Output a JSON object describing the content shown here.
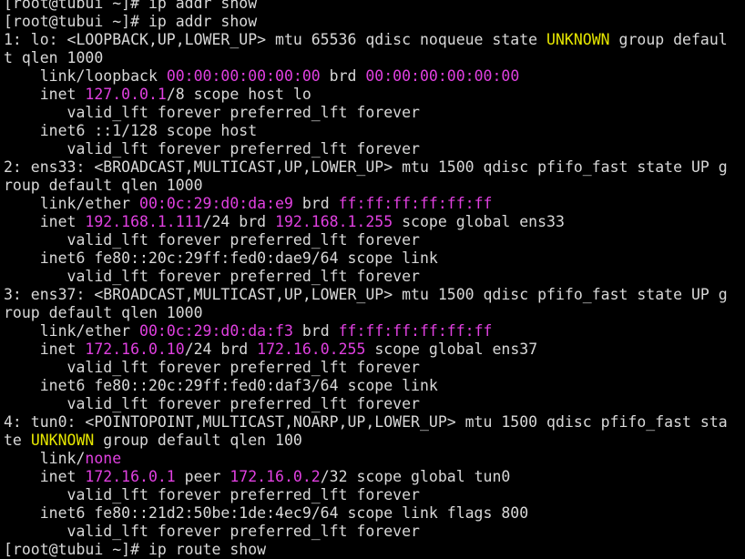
{
  "terminal": {
    "colors": {
      "background": "#000000",
      "text": "#d8d8d8",
      "address_highlight": "#e040e0",
      "state_highlight": "#e6e600"
    },
    "lines": [
      [
        {
          "t": "[root@tubui ~]# ip addr show"
        }
      ],
      [
        {
          "t": "[root@tubui ~]# ip addr show"
        }
      ],
      [
        {
          "t": "1: lo: <LOOPBACK,UP,LOWER_UP> mtu 65536 qdisc noqueue state "
        },
        {
          "t": "UNKNOWN",
          "c": "yel"
        },
        {
          "t": " group defaul"
        }
      ],
      [
        {
          "t": "t qlen 1000"
        }
      ],
      [
        {
          "t": "    link/loopback "
        },
        {
          "t": "00:00:00:00:00:00",
          "c": "mag"
        },
        {
          "t": " brd "
        },
        {
          "t": "00:00:00:00:00:00",
          "c": "mag"
        }
      ],
      [
        {
          "t": "    inet "
        },
        {
          "t": "127.0.0.1",
          "c": "mag"
        },
        {
          "t": "/8 scope host lo"
        }
      ],
      [
        {
          "t": "       valid_lft forever preferred_lft forever"
        }
      ],
      [
        {
          "t": "    inet6 ::1/128 scope host"
        }
      ],
      [
        {
          "t": "       valid_lft forever preferred_lft forever"
        }
      ],
      [
        {
          "t": "2: ens33: <BROADCAST,MULTICAST,UP,LOWER_UP> mtu 1500 qdisc pfifo_fast state UP g"
        }
      ],
      [
        {
          "t": "roup default qlen 1000"
        }
      ],
      [
        {
          "t": "    link/ether "
        },
        {
          "t": "00:0c:29:d0:da:e9",
          "c": "mag"
        },
        {
          "t": " brd "
        },
        {
          "t": "ff:ff:ff:ff:ff:ff",
          "c": "mag"
        }
      ],
      [
        {
          "t": "    inet "
        },
        {
          "t": "192.168.1.111",
          "c": "mag"
        },
        {
          "t": "/24 brd "
        },
        {
          "t": "192.168.1.255",
          "c": "mag"
        },
        {
          "t": " scope global ens33"
        }
      ],
      [
        {
          "t": "       valid_lft forever preferred_lft forever"
        }
      ],
      [
        {
          "t": "    inet6 fe80::20c:29ff:fed0:dae9/64 scope link"
        }
      ],
      [
        {
          "t": "       valid_lft forever preferred_lft forever"
        }
      ],
      [
        {
          "t": "3: ens37: <BROADCAST,MULTICAST,UP,LOWER_UP> mtu 1500 qdisc pfifo_fast state UP g"
        }
      ],
      [
        {
          "t": "roup default qlen 1000"
        }
      ],
      [
        {
          "t": "    link/ether "
        },
        {
          "t": "00:0c:29:d0:da:f3",
          "c": "mag"
        },
        {
          "t": " brd "
        },
        {
          "t": "ff:ff:ff:ff:ff:ff",
          "c": "mag"
        }
      ],
      [
        {
          "t": "    inet "
        },
        {
          "t": "172.16.0.10",
          "c": "mag"
        },
        {
          "t": "/24 brd "
        },
        {
          "t": "172.16.0.255",
          "c": "mag"
        },
        {
          "t": " scope global ens37"
        }
      ],
      [
        {
          "t": "       valid_lft forever preferred_lft forever"
        }
      ],
      [
        {
          "t": "    inet6 fe80::20c:29ff:fed0:daf3/64 scope link"
        }
      ],
      [
        {
          "t": "       valid_lft forever preferred_lft forever"
        }
      ],
      [
        {
          "t": "4: tun0: <POINTOPOINT,MULTICAST,NOARP,UP,LOWER_UP> mtu 1500 qdisc pfifo_fast sta"
        }
      ],
      [
        {
          "t": "te "
        },
        {
          "t": "UNKNOWN",
          "c": "yel"
        },
        {
          "t": " group default qlen 100"
        }
      ],
      [
        {
          "t": "    link/"
        },
        {
          "t": "none",
          "c": "mag"
        }
      ],
      [
        {
          "t": "    inet "
        },
        {
          "t": "172.16.0.1",
          "c": "mag"
        },
        {
          "t": " peer "
        },
        {
          "t": "172.16.0.2",
          "c": "mag"
        },
        {
          "t": "/32 scope global tun0"
        }
      ],
      [
        {
          "t": "       valid_lft forever preferred_lft forever"
        }
      ],
      [
        {
          "t": "    inet6 fe80::21d2:50be:1de:4ec9/64 scope link flags 800"
        }
      ],
      [
        {
          "t": "       valid_lft forever preferred_lft forever"
        }
      ],
      [
        {
          "t": "[root@tubui ~]# ip route show"
        }
      ]
    ]
  }
}
